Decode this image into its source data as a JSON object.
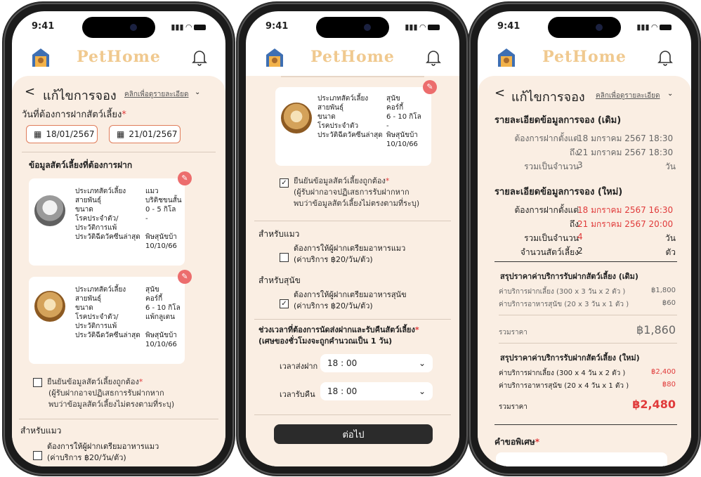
{
  "status": {
    "time": "9:41"
  },
  "app": {
    "name": "PetHome"
  },
  "screen1": {
    "back": "<",
    "title": "แก้ไขการจอง",
    "detail_link": "คลิกเพื่อดูรายละเอียด",
    "date_label": "วันที่ต้องการฝากสัตว์เลี้ยง",
    "required": "*",
    "date_from": "18/01/2567",
    "date_to": "21/01/2567",
    "pets_heading": "ข้อมูลสัตว์เลี้ยงที่ต้องการฝาก",
    "pets": [
      {
        "rows": [
          {
            "k": "ประเภทสัตว์เลี้ยง",
            "v": "แมว"
          },
          {
            "k": "สายพันธุ์",
            "v": "บริติชขนสั้น"
          },
          {
            "k": "ขนาด",
            "v": "0 - 5 กิโล"
          },
          {
            "k": "โรคประจำตัว/",
            "v": "-"
          },
          {
            "k": "ประวัติการแพ้",
            "v": ""
          },
          {
            "k": "ประวัติฉีดวัคซีนล่าสุด",
            "v": "พิษสุนัขบ้า"
          },
          {
            "k": "",
            "v": "10/10/66"
          }
        ]
      },
      {
        "rows": [
          {
            "k": "ประเภทสัตว์เลี้ยง",
            "v": "สุนัข"
          },
          {
            "k": "สายพันธุ์",
            "v": "คอร์กี้"
          },
          {
            "k": "ขนาด",
            "v": "6 - 10 กิโล"
          },
          {
            "k": "โรคประจำตัว/",
            "v": "แพ้กลูเตน"
          },
          {
            "k": "ประวัติการแพ้",
            "v": ""
          },
          {
            "k": "ประวัติฉีดวัคซีนล่าสุด",
            "v": "พิษสุนัขบ้า"
          },
          {
            "k": "",
            "v": "10/10/66"
          }
        ]
      }
    ],
    "confirm_line1": "ยืนยันข้อมูลสัตว์เลี้ยงถูกต้อง",
    "confirm_line2": "(ผู้รับฝากอาจปฏิเสธการรับฝากหาก",
    "confirm_line3": "พบว่าข้อมูลสัตว์เลี้ยงไม่ตรงตามที่ระบุ)",
    "cat_heading": "สำหรับแมว",
    "cat_food_line1": "ต้องการให้ผู้ฝากเตรียมอาหารแมว",
    "cat_food_line2": "(ค่าบริการ ฿20/วัน/ตัว)"
  },
  "screen2": {
    "dog_rows": [
      {
        "k": "ประเภทสัตว์เลี้ยง",
        "v": "สุนัข"
      },
      {
        "k": "สายพันธุ์",
        "v": "คอร์กี้"
      },
      {
        "k": "ขนาด",
        "v": "6 - 10 กิโล"
      },
      {
        "k": "โรคประจำตัว",
        "v": "-"
      },
      {
        "k": "ประวัติฉีดวัคซีนล่าสุด",
        "v": "พิษสุนัขบ้า"
      },
      {
        "k": "",
        "v": "10/10/66"
      }
    ],
    "confirm_line1": "ยืนยันข้อมูลสัตว์เลี้ยงถูกต้อง",
    "confirm_line2": "(ผู้รับฝากอาจปฏิเสธการรับฝากหาก",
    "confirm_line3": "พบว่าข้อมูลสัตว์เลี้ยงไม่ตรงตามที่ระบุ)",
    "cat_heading": "สำหรับแมว",
    "cat_food_line1": "ต้องการให้ผู้ฝากเตรียมอาหารแมว",
    "cat_food_line2": "(ค่าบริการ ฿20/วัน/ตัว)",
    "dog_heading": "สำหรับสุนัข",
    "dog_food_line1": "ต้องการให้ผู้ฝากเตรียมอาหารสุนัข",
    "dog_food_line2": "(ค่าบริการ ฿20/วัน/ตัว)",
    "time_heading": "ช่วงเวลาที่ต้องการนัดส่งฝากและรับคืนสัตว์เลี้ยง",
    "time_note": "(เศษของชั่วโมงจะถูกคำนวณเป็น 1 วัน)",
    "dropoff_label": "เวลาส่งฝาก",
    "dropoff_value": "18 : 00",
    "pickup_label": "เวลารับคืน",
    "pickup_value": "18 : 00",
    "next_button": "ต่อไป"
  },
  "screen3": {
    "title": "แก้ไขการจอง",
    "detail_link": "คลิกเพื่อดูรายละเอียด",
    "old_heading": "รายละเอียดข้อมูลการจอง (เดิม)",
    "old_from_label": "ต้องการฝากตั้งแต่",
    "old_from_value": "18 มกราคม 2567 18:30",
    "old_to_label": "ถึง",
    "old_to_value": "21 มกราคม 2567 18:30",
    "old_total_label": "รวมเป็นจำนวน",
    "old_total_value": "3",
    "day_unit": "วัน",
    "new_heading": "รายละเอียดข้อมูลการจอง (ใหม่)",
    "new_from_label": "ต้องการฝากตั้งแต่",
    "new_from_value": "18 มกราคม 2567 16:30",
    "new_to_label": "ถึง",
    "new_to_value": "21 มกราคม 2567 20:00",
    "new_total_label": "รวมเป็นจำนวน",
    "new_total_value": "4",
    "pets_count_label": "จำนวนสัตว์เลี้ยง",
    "pets_count_value": "2",
    "pet_unit": "ตัว",
    "old_price_heading": "สรุปราคาค่าบริการรับฝากสัตว์เลี้ยง (เดิม)",
    "old_fee1_label": "ค่าบริการฝากเลี้ยง (300 x 3 วัน x 2 ตัว )",
    "old_fee1_value": "฿1,800",
    "old_fee2_label": "ค่าบริการอาหารสุนัข (20 x 3 วัน x 1 ตัว )",
    "old_fee2_value": "฿60",
    "old_sum_label": "รวมราคา",
    "old_sum_value": "฿1,860",
    "new_price_heading": "สรุปราคาค่าบริการรับฝากสัตว์เลี้ยง (ใหม่)",
    "new_fee1_label": "ค่าบริการฝากเลี้ยง (300 x 4 วัน x 2 ตัว )",
    "new_fee1_value": "฿2,400",
    "new_fee2_label": "ค่าบริการอาหารสุนัข (20 x 4 วัน x 1 ตัว )",
    "new_fee2_value": "฿80",
    "new_sum_label": "รวมราคา",
    "new_sum_value": "฿2,480",
    "special_label": "คำขอพิเศษ",
    "required": "*"
  }
}
